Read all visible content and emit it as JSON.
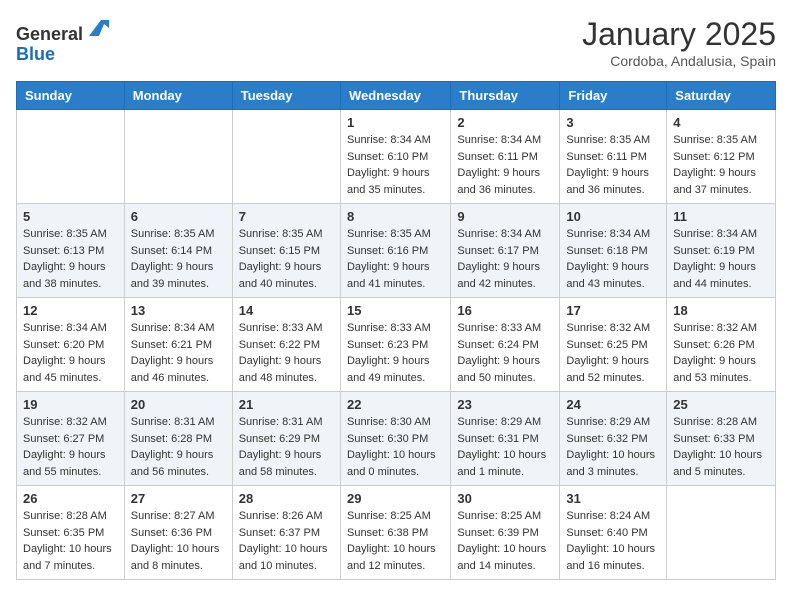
{
  "logo": {
    "text_general": "General",
    "text_blue": "Blue"
  },
  "title": "January 2025",
  "location": "Cordoba, Andalusia, Spain",
  "days_of_week": [
    "Sunday",
    "Monday",
    "Tuesday",
    "Wednesday",
    "Thursday",
    "Friday",
    "Saturday"
  ],
  "weeks": [
    [
      {
        "day": "",
        "info": ""
      },
      {
        "day": "",
        "info": ""
      },
      {
        "day": "",
        "info": ""
      },
      {
        "day": "1",
        "info": "Sunrise: 8:34 AM\nSunset: 6:10 PM\nDaylight: 9 hours and 35 minutes."
      },
      {
        "day": "2",
        "info": "Sunrise: 8:34 AM\nSunset: 6:11 PM\nDaylight: 9 hours and 36 minutes."
      },
      {
        "day": "3",
        "info": "Sunrise: 8:35 AM\nSunset: 6:11 PM\nDaylight: 9 hours and 36 minutes."
      },
      {
        "day": "4",
        "info": "Sunrise: 8:35 AM\nSunset: 6:12 PM\nDaylight: 9 hours and 37 minutes."
      }
    ],
    [
      {
        "day": "5",
        "info": "Sunrise: 8:35 AM\nSunset: 6:13 PM\nDaylight: 9 hours and 38 minutes."
      },
      {
        "day": "6",
        "info": "Sunrise: 8:35 AM\nSunset: 6:14 PM\nDaylight: 9 hours and 39 minutes."
      },
      {
        "day": "7",
        "info": "Sunrise: 8:35 AM\nSunset: 6:15 PM\nDaylight: 9 hours and 40 minutes."
      },
      {
        "day": "8",
        "info": "Sunrise: 8:35 AM\nSunset: 6:16 PM\nDaylight: 9 hours and 41 minutes."
      },
      {
        "day": "9",
        "info": "Sunrise: 8:34 AM\nSunset: 6:17 PM\nDaylight: 9 hours and 42 minutes."
      },
      {
        "day": "10",
        "info": "Sunrise: 8:34 AM\nSunset: 6:18 PM\nDaylight: 9 hours and 43 minutes."
      },
      {
        "day": "11",
        "info": "Sunrise: 8:34 AM\nSunset: 6:19 PM\nDaylight: 9 hours and 44 minutes."
      }
    ],
    [
      {
        "day": "12",
        "info": "Sunrise: 8:34 AM\nSunset: 6:20 PM\nDaylight: 9 hours and 45 minutes."
      },
      {
        "day": "13",
        "info": "Sunrise: 8:34 AM\nSunset: 6:21 PM\nDaylight: 9 hours and 46 minutes."
      },
      {
        "day": "14",
        "info": "Sunrise: 8:33 AM\nSunset: 6:22 PM\nDaylight: 9 hours and 48 minutes."
      },
      {
        "day": "15",
        "info": "Sunrise: 8:33 AM\nSunset: 6:23 PM\nDaylight: 9 hours and 49 minutes."
      },
      {
        "day": "16",
        "info": "Sunrise: 8:33 AM\nSunset: 6:24 PM\nDaylight: 9 hours and 50 minutes."
      },
      {
        "day": "17",
        "info": "Sunrise: 8:32 AM\nSunset: 6:25 PM\nDaylight: 9 hours and 52 minutes."
      },
      {
        "day": "18",
        "info": "Sunrise: 8:32 AM\nSunset: 6:26 PM\nDaylight: 9 hours and 53 minutes."
      }
    ],
    [
      {
        "day": "19",
        "info": "Sunrise: 8:32 AM\nSunset: 6:27 PM\nDaylight: 9 hours and 55 minutes."
      },
      {
        "day": "20",
        "info": "Sunrise: 8:31 AM\nSunset: 6:28 PM\nDaylight: 9 hours and 56 minutes."
      },
      {
        "day": "21",
        "info": "Sunrise: 8:31 AM\nSunset: 6:29 PM\nDaylight: 9 hours and 58 minutes."
      },
      {
        "day": "22",
        "info": "Sunrise: 8:30 AM\nSunset: 6:30 PM\nDaylight: 10 hours and 0 minutes."
      },
      {
        "day": "23",
        "info": "Sunrise: 8:29 AM\nSunset: 6:31 PM\nDaylight: 10 hours and 1 minute."
      },
      {
        "day": "24",
        "info": "Sunrise: 8:29 AM\nSunset: 6:32 PM\nDaylight: 10 hours and 3 minutes."
      },
      {
        "day": "25",
        "info": "Sunrise: 8:28 AM\nSunset: 6:33 PM\nDaylight: 10 hours and 5 minutes."
      }
    ],
    [
      {
        "day": "26",
        "info": "Sunrise: 8:28 AM\nSunset: 6:35 PM\nDaylight: 10 hours and 7 minutes."
      },
      {
        "day": "27",
        "info": "Sunrise: 8:27 AM\nSunset: 6:36 PM\nDaylight: 10 hours and 8 minutes."
      },
      {
        "day": "28",
        "info": "Sunrise: 8:26 AM\nSunset: 6:37 PM\nDaylight: 10 hours and 10 minutes."
      },
      {
        "day": "29",
        "info": "Sunrise: 8:25 AM\nSunset: 6:38 PM\nDaylight: 10 hours and 12 minutes."
      },
      {
        "day": "30",
        "info": "Sunrise: 8:25 AM\nSunset: 6:39 PM\nDaylight: 10 hours and 14 minutes."
      },
      {
        "day": "31",
        "info": "Sunrise: 8:24 AM\nSunset: 6:40 PM\nDaylight: 10 hours and 16 minutes."
      },
      {
        "day": "",
        "info": ""
      }
    ]
  ]
}
